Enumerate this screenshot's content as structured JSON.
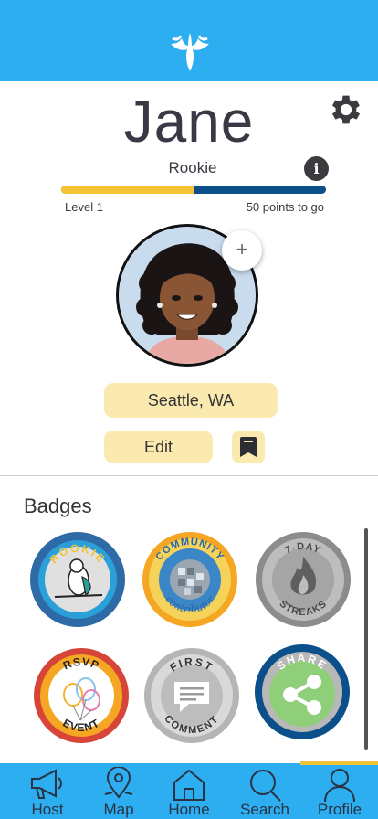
{
  "header": {
    "logo_icon": "bird-logo-icon"
  },
  "profile": {
    "name": "Jane",
    "level_title": "Rookie",
    "level_label": "Level 1",
    "points_to_go": "50 points to go",
    "progress_fraction": 0.5,
    "location": "Seattle, WA",
    "edit_label": "Edit",
    "add_photo_symbol": "+",
    "info_symbol": "i"
  },
  "badges": {
    "title": "Badges",
    "items": [
      {
        "top": "ROOKIE",
        "bottom": "",
        "icon": "parrot-icon"
      },
      {
        "top": "COMMUNITY",
        "bottom": "contributor",
        "icon": "disco-ball-icon"
      },
      {
        "top": "7-DAY",
        "bottom": "STREAKS",
        "icon": "flame-icon"
      },
      {
        "top": "RSVP",
        "bottom": "EVENT",
        "icon": "balloons-icon"
      },
      {
        "top": "FIRST",
        "bottom": "COMMENT",
        "icon": "comment-icon"
      },
      {
        "top": "SHARE",
        "bottom": "",
        "icon": "share-icon"
      }
    ]
  },
  "nav": {
    "tabs": [
      {
        "label": "Host",
        "icon": "megaphone-icon"
      },
      {
        "label": "Map",
        "icon": "map-pin-icon"
      },
      {
        "label": "Home",
        "icon": "home-icon"
      },
      {
        "label": "Search",
        "icon": "search-icon"
      },
      {
        "label": "Profile",
        "icon": "person-icon",
        "active": true
      }
    ]
  },
  "colors": {
    "primary_blue": "#2caef0",
    "accent_yellow": "#f5c436",
    "progress_dark": "#0b4f8b",
    "chip_bg": "#faeab0"
  }
}
